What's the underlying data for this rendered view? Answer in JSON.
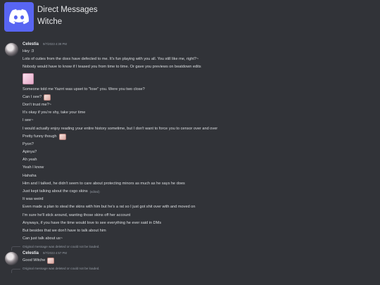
{
  "header": {
    "title": "Direct Messages",
    "subtitle": "Witche",
    "logo_icon": "discord-logo-icon",
    "accent": "#5865f2"
  },
  "groups": [
    {
      "author": "Celestia",
      "timestamp": "9/7/2023 4:39 PM",
      "lines": [
        {
          "text": "Hey :3"
        },
        {
          "text": "Lots of cuties from the doxx have defected to me. It's fun playing with you all. You still like me, right?~"
        },
        {
          "text": "Nobody would have to know if I teased you from time to time. Or gave you previews on beatdown edits"
        },
        {
          "text": "",
          "big_emoji": true
        },
        {
          "text": "Someone told me Yazrri was upset to \"lose\" you. Were you two close?"
        },
        {
          "text": "Can I see?",
          "emoji": true
        },
        {
          "text": "Don't trust me?~"
        },
        {
          "text": "It's okay if you're shy, take your time"
        },
        {
          "text": "I see~"
        },
        {
          "text": "I would actually enjoy reading your entire history sometime, but I don't want to force you to censor over and over"
        },
        {
          "text": "Pretty funny though",
          "emoji": true
        },
        {
          "text": "Pyon?"
        },
        {
          "text": "Apinya?"
        },
        {
          "text": "Ah yeah"
        },
        {
          "text": "Yeah I know"
        },
        {
          "text": "Hahaha"
        },
        {
          "text": "Him and I talked, he didn't seem to care about protecting minors as much as he says he does"
        },
        {
          "text": "Just kept talking about the csgo skins",
          "edited": "(edited)"
        },
        {
          "text": "It was weird"
        },
        {
          "text": "Even made a plan to steal the skins with him but he's a rat so I just got shit over with and moved on"
        },
        {
          "text": "I'm sure he'll stick around, wanting those skins off her account"
        },
        {
          "text": "Anyways, if you have the time would love to see everything he ever said in DMs"
        },
        {
          "text": "But besides that we don't have to talk about him"
        },
        {
          "text": "Can just talk about us~"
        }
      ]
    }
  ],
  "reply_1": "Original message was deleted or could not be loaded.",
  "group2": {
    "author": "Celestia",
    "timestamp": "9/7/2023 4:57 PM",
    "text": "Good Witche"
  },
  "reply_2": "Original message was deleted or could not be loaded."
}
